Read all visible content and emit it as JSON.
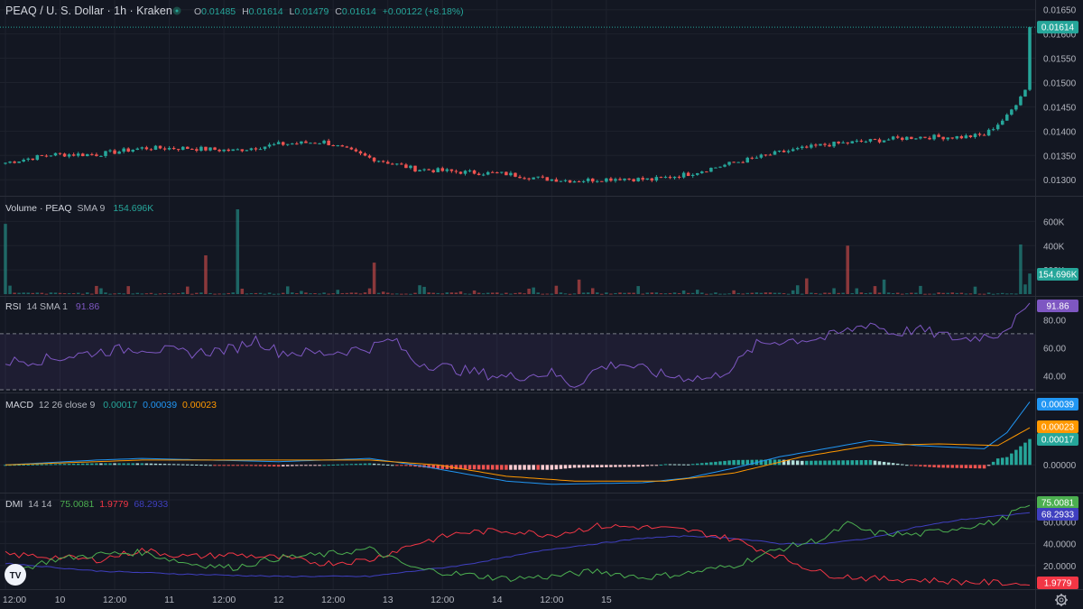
{
  "header": {
    "symbol": "PEAQ / U. S. Dollar · 1h · Kraken",
    "o_label": "O",
    "o_value": "0.01485",
    "h_label": "H",
    "h_value": "0.01614",
    "l_label": "L",
    "l_value": "0.01479",
    "c_label": "C",
    "c_value": "0.01614",
    "change": "+0.00122 (+8.18%)"
  },
  "colors": {
    "background": "#131722",
    "grid": "#1e222d",
    "up": "#26a69a",
    "down": "#ef5350",
    "text": "#d1d4dc",
    "axis_text": "#b2b5be",
    "rsi": "#7e57c2",
    "macd": "#2196f3",
    "signal": "#ff9800",
    "di_plus": "#4caf50",
    "di_minus": "#f23645",
    "adx": "#3f3fbf"
  },
  "logo": "TV",
  "chart_data": [
    {
      "type": "candlestick",
      "title": "PEAQ / U. S. Dollar · 1h · Kraken",
      "price_ticks": [
        "0.01650",
        "0.01600",
        "0.01550",
        "0.01500",
        "0.01450",
        "0.01400",
        "0.01350",
        "0.01300"
      ],
      "ylim": [
        0.0128,
        0.01655
      ],
      "last_price_label": "0.01614",
      "x_labels": [
        "12:00",
        "10",
        "12:00",
        "11",
        "12:00",
        "12",
        "12:00",
        "13",
        "12:00",
        "14",
        "12:00",
        "15"
      ],
      "close_anchors": [
        [
          0,
          0.01335
        ],
        [
          10,
          0.01352
        ],
        [
          20,
          0.01352
        ],
        [
          30,
          0.01365
        ],
        [
          40,
          0.01365
        ],
        [
          50,
          0.0136
        ],
        [
          60,
          0.01373
        ],
        [
          70,
          0.01378
        ],
        [
          80,
          0.01345
        ],
        [
          90,
          0.01322
        ],
        [
          100,
          0.01316
        ],
        [
          110,
          0.01312
        ],
        [
          118,
          0.01302
        ],
        [
          125,
          0.01298
        ],
        [
          135,
          0.01303
        ],
        [
          142,
          0.013
        ],
        [
          150,
          0.01312
        ],
        [
          160,
          0.01335
        ],
        [
          170,
          0.01356
        ],
        [
          180,
          0.01372
        ],
        [
          190,
          0.0138
        ],
        [
          200,
          0.01388
        ],
        [
          210,
          0.01388
        ],
        [
          215,
          0.01392
        ],
        [
          220,
          0.0143
        ],
        [
          224,
          0.01485
        ],
        [
          225,
          0.01614
        ]
      ],
      "bars": 226
    },
    {
      "type": "bar",
      "title": "Volume · PEAQ",
      "sma_label": "SMA 9",
      "sma_value": "154.696K",
      "ticks": [
        "600K",
        "400K",
        "200K"
      ],
      "ylim": [
        0,
        700000
      ],
      "last_value_label": "154.696K",
      "spikes": [
        [
          0,
          580000
        ],
        [
          1,
          70000
        ],
        [
          44,
          320000
        ],
        [
          51,
          700000
        ],
        [
          81,
          260000
        ],
        [
          126,
          120000
        ],
        [
          176,
          130000
        ],
        [
          185,
          400000
        ],
        [
          193,
          120000
        ],
        [
          223,
          410000
        ],
        [
          224,
          80000
        ],
        [
          225,
          170000
        ]
      ]
    },
    {
      "type": "line",
      "title": "RSI",
      "params": "14 SMA 1",
      "value_label": "91.86",
      "ticks": [
        "80.00",
        "60.00",
        "40.00"
      ],
      "ylim": [
        30,
        95
      ],
      "band": [
        30,
        70
      ],
      "anchors": [
        [
          0,
          50
        ],
        [
          10,
          52
        ],
        [
          20,
          57
        ],
        [
          30,
          60
        ],
        [
          40,
          56
        ],
        [
          50,
          59
        ],
        [
          55,
          66
        ],
        [
          60,
          57
        ],
        [
          70,
          56
        ],
        [
          80,
          60
        ],
        [
          85,
          66
        ],
        [
          90,
          50
        ],
        [
          100,
          44
        ],
        [
          110,
          39
        ],
        [
          120,
          42
        ],
        [
          125,
          33
        ],
        [
          130,
          45
        ],
        [
          135,
          49
        ],
        [
          145,
          40
        ],
        [
          155,
          38
        ],
        [
          160,
          47
        ],
        [
          165,
          62
        ],
        [
          170,
          65
        ],
        [
          180,
          67
        ],
        [
          185,
          72
        ],
        [
          190,
          78
        ],
        [
          195,
          70
        ],
        [
          200,
          73
        ],
        [
          210,
          66
        ],
        [
          218,
          70
        ],
        [
          222,
          80
        ],
        [
          225,
          91.86
        ]
      ]
    },
    {
      "type": "line",
      "title": "MACD",
      "params": "12 26 close 9",
      "macd_value": "0.00017",
      "signal_value": "0.00039",
      "hist_value": "0.00023",
      "tick": "0.00000",
      "value_labels": [
        "0.00039",
        "0.00023",
        "0.00017"
      ],
      "macd_anchors": [
        [
          0,
          0.0
        ],
        [
          20,
          3e-05
        ],
        [
          30,
          4e-05
        ],
        [
          60,
          2e-05
        ],
        [
          80,
          4e-05
        ],
        [
          90,
          0.0
        ],
        [
          100,
          -5e-05
        ],
        [
          110,
          -0.0001
        ],
        [
          120,
          -0.00012
        ],
        [
          140,
          -0.00011
        ],
        [
          150,
          -8e-05
        ],
        [
          160,
          -2e-05
        ],
        [
          170,
          5e-05
        ],
        [
          180,
          0.0001
        ],
        [
          190,
          0.00015
        ],
        [
          200,
          0.00012
        ],
        [
          215,
          0.0001
        ],
        [
          220,
          0.0002
        ],
        [
          225,
          0.00039
        ]
      ],
      "signal_anchors": [
        [
          0,
          0.0
        ],
        [
          30,
          3e-05
        ],
        [
          80,
          3e-05
        ],
        [
          95,
          0.0
        ],
        [
          110,
          -7e-05
        ],
        [
          125,
          -0.0001
        ],
        [
          145,
          -0.0001
        ],
        [
          160,
          -5e-05
        ],
        [
          175,
          5e-05
        ],
        [
          190,
          0.00012
        ],
        [
          205,
          0.00013
        ],
        [
          218,
          0.00012
        ],
        [
          225,
          0.00023
        ]
      ]
    },
    {
      "type": "line",
      "title": "DMI",
      "params": "14 14",
      "di_plus_value": "75.0081",
      "di_minus_value": "1.9779",
      "adx_value": "68.2933",
      "ticks": [
        "80.0000",
        "60.0000",
        "40.0000",
        "20.0000"
      ],
      "ylim": [
        0,
        85
      ],
      "value_labels": [
        "75.0081",
        "68.2933",
        "1.9779"
      ],
      "plus_anchors": [
        [
          0,
          12
        ],
        [
          10,
          25
        ],
        [
          20,
          30
        ],
        [
          30,
          32
        ],
        [
          40,
          22
        ],
        [
          50,
          18
        ],
        [
          60,
          27
        ],
        [
          70,
          30
        ],
        [
          80,
          35
        ],
        [
          90,
          17
        ],
        [
          100,
          12
        ],
        [
          110,
          8
        ],
        [
          120,
          10
        ],
        [
          130,
          15
        ],
        [
          140,
          9
        ],
        [
          150,
          13
        ],
        [
          160,
          20
        ],
        [
          170,
          35
        ],
        [
          180,
          45
        ],
        [
          185,
          58
        ],
        [
          190,
          50
        ],
        [
          200,
          48
        ],
        [
          210,
          55
        ],
        [
          218,
          60
        ],
        [
          222,
          70
        ],
        [
          225,
          75
        ]
      ],
      "minus_anchors": [
        [
          0,
          30
        ],
        [
          10,
          28
        ],
        [
          20,
          25
        ],
        [
          30,
          34
        ],
        [
          40,
          28
        ],
        [
          50,
          30
        ],
        [
          60,
          27
        ],
        [
          70,
          22
        ],
        [
          80,
          25
        ],
        [
          90,
          40
        ],
        [
          100,
          50
        ],
        [
          110,
          52
        ],
        [
          120,
          48
        ],
        [
          130,
          56
        ],
        [
          140,
          55
        ],
        [
          150,
          52
        ],
        [
          160,
          44
        ],
        [
          170,
          28
        ],
        [
          180,
          12
        ],
        [
          190,
          8
        ],
        [
          200,
          7
        ],
        [
          210,
          5
        ],
        [
          220,
          4
        ],
        [
          225,
          1.98
        ]
      ],
      "adx_anchors": [
        [
          0,
          22
        ],
        [
          20,
          15
        ],
        [
          40,
          12
        ],
        [
          60,
          10
        ],
        [
          80,
          10
        ],
        [
          100,
          20
        ],
        [
          120,
          35
        ],
        [
          140,
          45
        ],
        [
          150,
          47
        ],
        [
          160,
          45
        ],
        [
          170,
          40
        ],
        [
          180,
          40
        ],
        [
          190,
          45
        ],
        [
          200,
          55
        ],
        [
          210,
          62
        ],
        [
          220,
          66
        ],
        [
          225,
          68.29
        ]
      ]
    }
  ]
}
